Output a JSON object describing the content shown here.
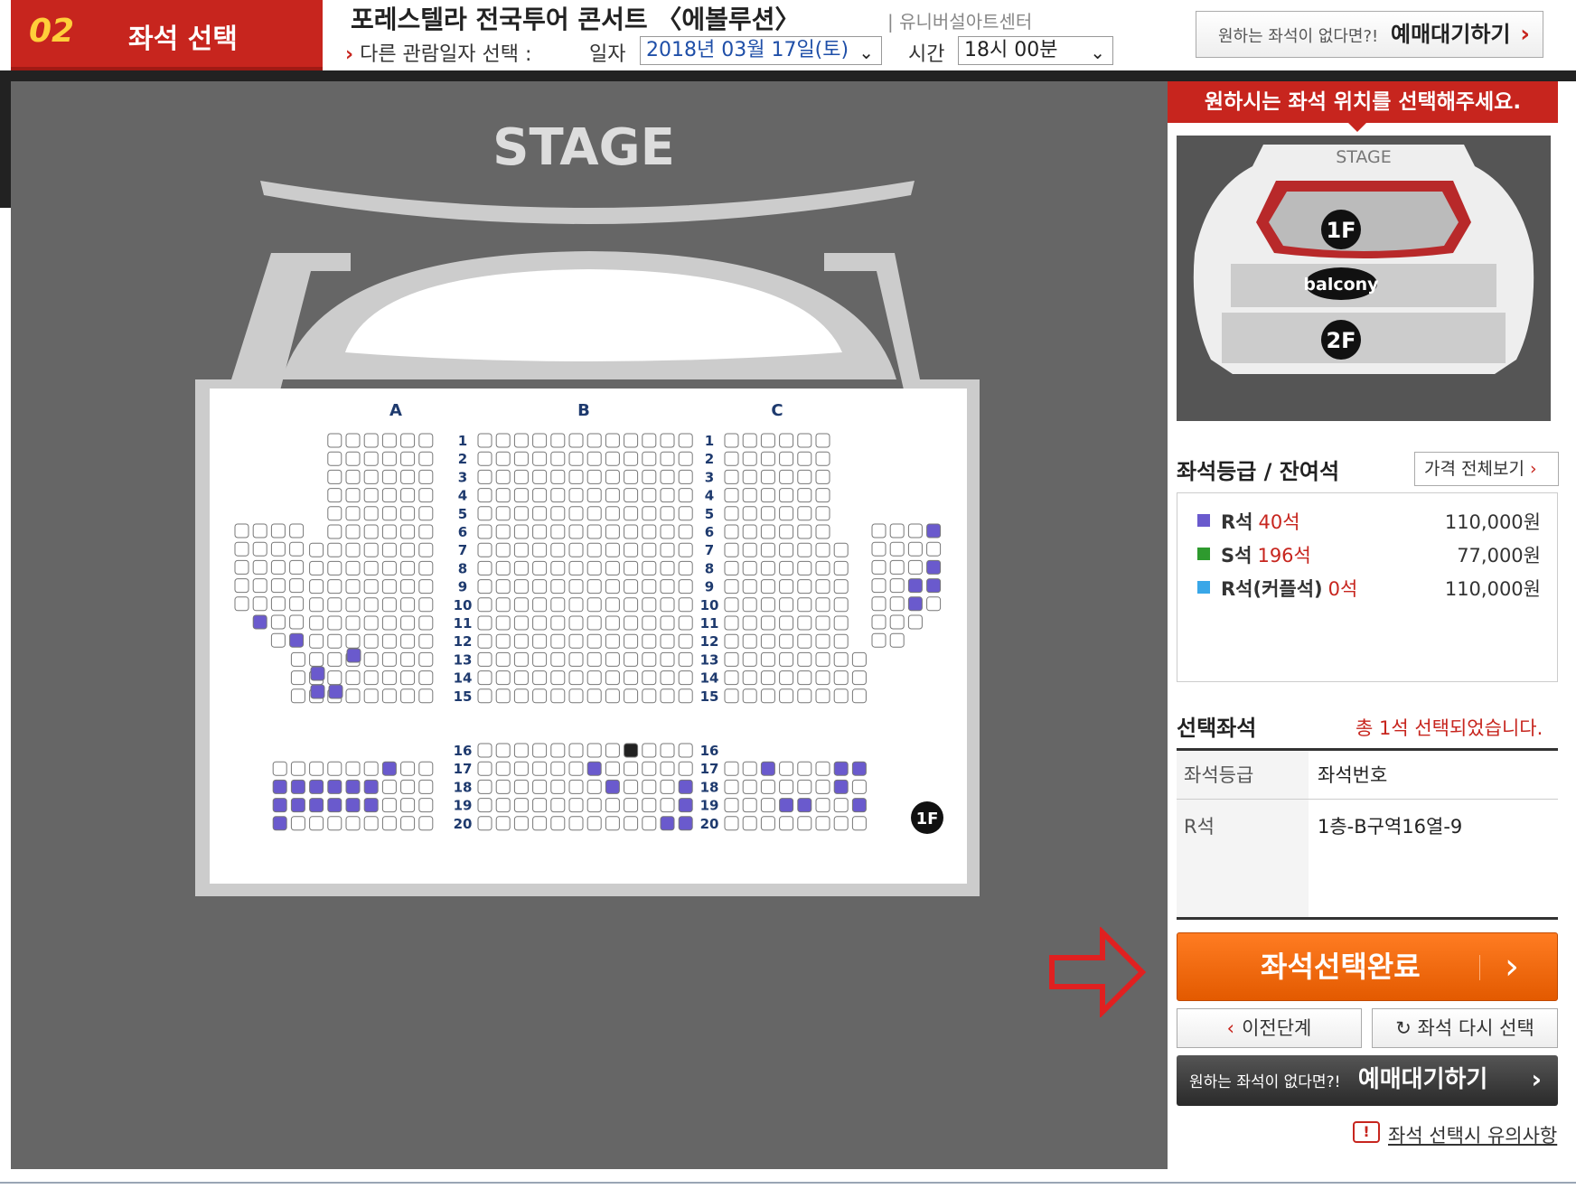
{
  "header": {
    "step_number": "02",
    "step_title": "좌석 선택",
    "concert_title": "포레스텔라 전국투어 콘서트 〈에볼루션〉",
    "venue": "| 유니버설아트센터",
    "other_date_label": "다른 관람일자 선택 :",
    "date_label": "일자",
    "date_value": "2018년 03월 17일(토)",
    "time_label": "시간",
    "time_value": "18시 00분",
    "waitlist_prefix": "원하는 좌석이 없다면?!",
    "waitlist_label": "예매대기하기"
  },
  "seatmap": {
    "stage_label": "STAGE",
    "section_labels": [
      "A",
      "B",
      "C"
    ],
    "row_numbers_upper": [
      "1",
      "2",
      "3",
      "4",
      "5",
      "6",
      "7",
      "8",
      "9",
      "10",
      "11",
      "12",
      "13",
      "14",
      "15"
    ],
    "row_numbers_lower": [
      "16",
      "17",
      "18",
      "19",
      "20"
    ],
    "floor_badge": "1F",
    "colors": {
      "background": "#666666",
      "hall": "#ffffff",
      "available_seat": "#6a5acd",
      "occupied_seat": "#ffffff",
      "selected_seat": "#222222"
    }
  },
  "panel": {
    "banner": "원하시는 좌석 위치를 선택해주세요.",
    "minimap": {
      "stage": "STAGE",
      "floor1": "1F",
      "balcony": "balcony",
      "floor2": "2F"
    },
    "grade_title": "좌석등급 / 잔여석",
    "price_all_label": "가격 전체보기",
    "grades": [
      {
        "name": "R석",
        "count": "40석",
        "price": "110,000원",
        "color": "#6a5acd"
      },
      {
        "name": "S석",
        "count": "196석",
        "price": "77,000원",
        "color": "#2e9a2e"
      },
      {
        "name": "R석(커플석)",
        "count": "0석",
        "price": "110,000원",
        "color": "#39a7e8"
      }
    ],
    "selected_title": "선택좌석",
    "selected_count": "총 1석 선택되었습니다.",
    "table_header_grade": "좌석등급",
    "table_header_seat": "좌석번호",
    "selected_grade": "R석",
    "selected_seat": "1층-B구역16열-9",
    "complete_label": "좌석선택완료",
    "prev_label": "이전단계",
    "reselect_label": "좌석 다시 선택",
    "waitlist_prefix": "원하는 좌석이 없다면?!",
    "waitlist_label": "예매대기하기",
    "notice_label": "좌석 선택시 유의사항"
  }
}
